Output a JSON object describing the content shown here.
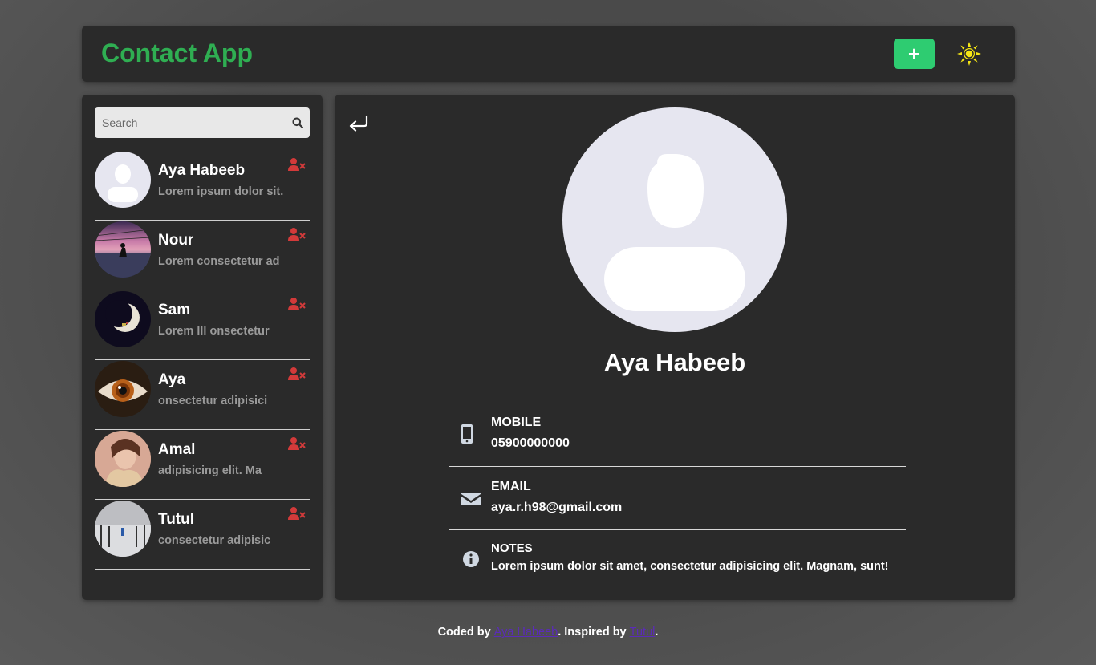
{
  "header": {
    "title": "Contact App",
    "add_label": "+",
    "add_icon": "plus-icon",
    "theme_icon": "sun-icon"
  },
  "colors": {
    "accent": "#2fae52",
    "add_button": "#2ecc71",
    "delete_icon": "#d33a3a",
    "sun": "#f5e614",
    "panel": "#2a2a2a",
    "link": "#5b2bb8"
  },
  "search": {
    "placeholder": "Search",
    "value": "",
    "icon": "search-icon"
  },
  "contacts": [
    {
      "name": "Aya Habeeb",
      "desc": "Lorem ipsum dolor sit."
    },
    {
      "name": "Nour",
      "desc": "Lorem consectetur ad"
    },
    {
      "name": "Sam",
      "desc": "Lorem lll onsectetur"
    },
    {
      "name": "Aya",
      "desc": "onsectetur adipisici"
    },
    {
      "name": "Amal",
      "desc": "adipisicing elit. Ma"
    },
    {
      "name": "Tutul",
      "desc": "consectetur adipisic"
    }
  ],
  "detail": {
    "back_icon": "back-arrow-icon",
    "name": "Aya Habeeb",
    "mobile_label": "MOBILE",
    "mobile_value": "05900000000",
    "email_label": "EMAIL",
    "email_value": "aya.r.h98@gmail.com",
    "notes_label": "NOTES",
    "notes_value": "Lorem ipsum dolor sit amet, consectetur adipisicing elit. Magnam, sunt!"
  },
  "footer": {
    "prefix": "Coded by",
    "author": "Aya Habeeb",
    "middle": ". Inspired by",
    "inspired": "Tutul",
    "suffix": "."
  }
}
